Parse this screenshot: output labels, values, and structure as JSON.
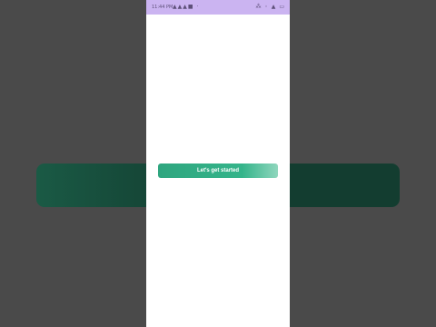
{
  "status_bar": {
    "time": "11:44 PM",
    "icons": "▲▲▲■ ·",
    "right_icons": "⁂ ◦ ▲ ▭"
  },
  "main": {
    "cta_label": "Let's get started"
  },
  "colors": {
    "status_bar": "#cbb4f1",
    "button": "#34b48a",
    "backdrop": "#4a4a4a"
  }
}
